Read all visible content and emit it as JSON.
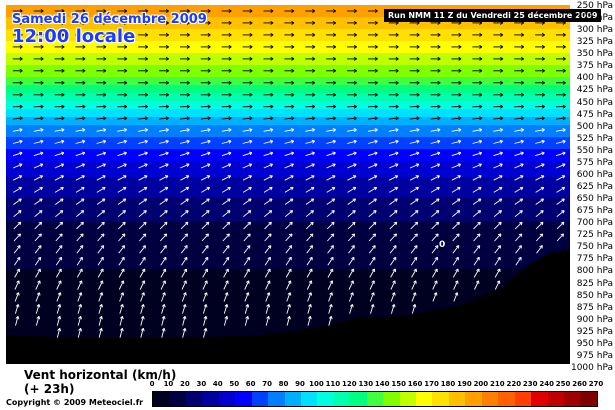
{
  "chart_data": {
    "type": "heatmap",
    "date_label": "Samedi 26 décembre 2009",
    "time_label": "12:00 locale",
    "run_label": "Run NMM 11 Z du Vendredi 25 décembre 2009",
    "quantity_label_line1": "Vent horizontal (km/h)",
    "quantity_label_line2": "(+ 23h)",
    "copyright": "Copyright © 2009 Meteociel.fr",
    "y_axis_levels": [
      "250 hPa",
      "275 hPa",
      "300 hPa",
      "325 hPa",
      "350 hPa",
      "375 hPa",
      "400 hPa",
      "425 hPa",
      "450 hPa",
      "475 hPa",
      "500 hPa",
      "525 hPa",
      "550 hPa",
      "575 hPa",
      "600 hPa",
      "625 hPa",
      "650 hPa",
      "675 hPa",
      "700 hPa",
      "725 hPa",
      "750 hPa",
      "775 hPa",
      "800 hPa",
      "825 hPa",
      "850 hPa",
      "875 hPa",
      "900 hPa",
      "925 hPa",
      "950 hPa",
      "975 hPa",
      "1000 hPa"
    ],
    "y_range_hpa": [
      250,
      1000
    ],
    "color_scale_ticks": [
      "0",
      "10",
      "20",
      "30",
      "40",
      "50",
      "60",
      "70",
      "80",
      "90",
      "100",
      "110",
      "120",
      "130",
      "140",
      "150",
      "160",
      "170",
      "180",
      "190",
      "200",
      "210",
      "220",
      "230",
      "240",
      "250",
      "260",
      "270"
    ],
    "annotation": "0",
    "wind_speed_profile": [
      {
        "pressure": 250,
        "speed": 200
      },
      {
        "pressure": 275,
        "speed": 190
      },
      {
        "pressure": 300,
        "speed": 180
      },
      {
        "pressure": 325,
        "speed": 170
      },
      {
        "pressure": 350,
        "speed": 160
      },
      {
        "pressure": 375,
        "speed": 150
      },
      {
        "pressure": 400,
        "speed": 140
      },
      {
        "pressure": 425,
        "speed": 125
      },
      {
        "pressure": 450,
        "speed": 110
      },
      {
        "pressure": 475,
        "speed": 95
      },
      {
        "pressure": 500,
        "speed": 80
      },
      {
        "pressure": 525,
        "speed": 70
      },
      {
        "pressure": 550,
        "speed": 60
      },
      {
        "pressure": 575,
        "speed": 50
      },
      {
        "pressure": 600,
        "speed": 42
      },
      {
        "pressure": 625,
        "speed": 36
      },
      {
        "pressure": 650,
        "speed": 30
      },
      {
        "pressure": 675,
        "speed": 25
      },
      {
        "pressure": 700,
        "speed": 20
      },
      {
        "pressure": 750,
        "speed": 15
      },
      {
        "pressure": 800,
        "speed": 10
      },
      {
        "pressure": 850,
        "speed": 8
      },
      {
        "pressure": 900,
        "speed": 6
      },
      {
        "pressure": 950,
        "speed": 5
      },
      {
        "pressure": 1000,
        "speed": 3
      }
    ],
    "terrain_profile": [
      {
        "x": 0.0,
        "pressure": 940
      },
      {
        "x": 0.15,
        "pressure": 945
      },
      {
        "x": 0.3,
        "pressure": 945
      },
      {
        "x": 0.45,
        "pressure": 940
      },
      {
        "x": 0.55,
        "pressure": 925
      },
      {
        "x": 0.62,
        "pressure": 905
      },
      {
        "x": 0.7,
        "pressure": 900
      },
      {
        "x": 0.8,
        "pressure": 880
      },
      {
        "x": 0.88,
        "pressure": 840
      },
      {
        "x": 0.93,
        "pressure": 790
      },
      {
        "x": 0.97,
        "pressure": 765
      },
      {
        "x": 1.0,
        "pressure": 760
      }
    ],
    "colors": [
      "#000020",
      "#000040",
      "#000070",
      "#0000a0",
      "#0000d0",
      "#0000ff",
      "#0040ff",
      "#0080ff",
      "#00b0ff",
      "#00e0ff",
      "#00ffe0",
      "#00ffb0",
      "#00ff80",
      "#40ff40",
      "#80ff00",
      "#c0ff00",
      "#ffff00",
      "#ffe000",
      "#ffc000",
      "#ffa000",
      "#ff8000",
      "#ff6000",
      "#ff4000",
      "#e00000",
      "#c00000",
      "#a00000",
      "#800000"
    ]
  }
}
